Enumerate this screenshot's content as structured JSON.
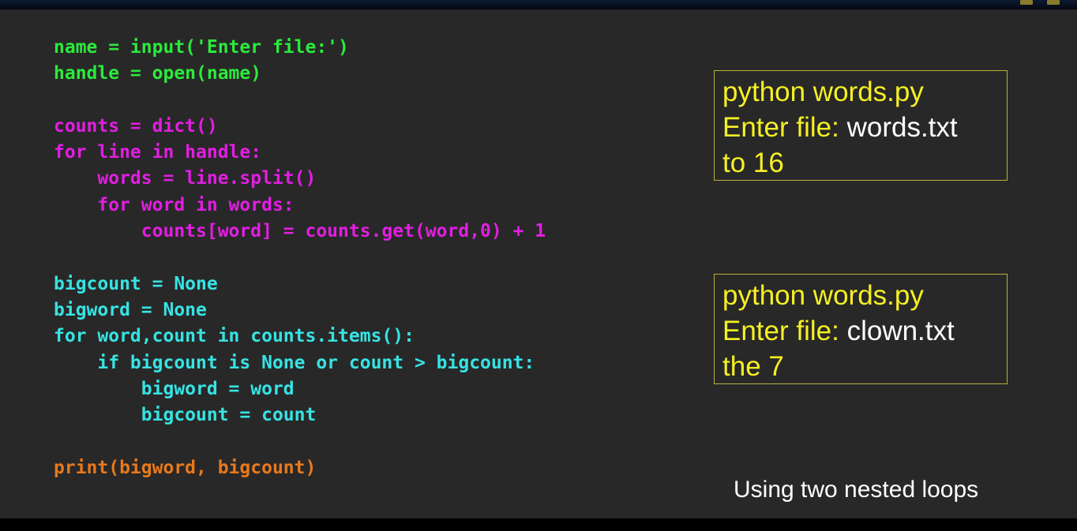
{
  "code": {
    "lines": [
      "name = input('Enter file:')",
      "handle = open(name)",
      "",
      "counts = dict()",
      "for line in handle:",
      "    words = line.split()",
      "    for word in words:",
      "        counts[word] = counts.get(word,0) + 1",
      "",
      "bigcount = None",
      "bigword = None",
      "for word,count in counts.items():",
      "    if bigcount is None or count > bigcount:",
      "        bigword = word",
      "        bigcount = count",
      "",
      "print(bigword, bigcount)"
    ]
  },
  "output1": {
    "command": "python words.py",
    "prompt": "Enter file: ",
    "input": "words.txt",
    "result": "to 16"
  },
  "output2": {
    "command": "python words.py",
    "prompt": "Enter file: ",
    "input": "clown.txt",
    "result": "the 7"
  },
  "caption": "Using two nested loops",
  "colors": {
    "background": "#282828",
    "code_input": "#2bea3b",
    "code_counting": "#e21ee2",
    "code_search": "#37e3e3",
    "code_print": "#e8791c",
    "output_text": "#f5f024",
    "output_input": "#ffffff",
    "output_border": "#b9b23a"
  }
}
